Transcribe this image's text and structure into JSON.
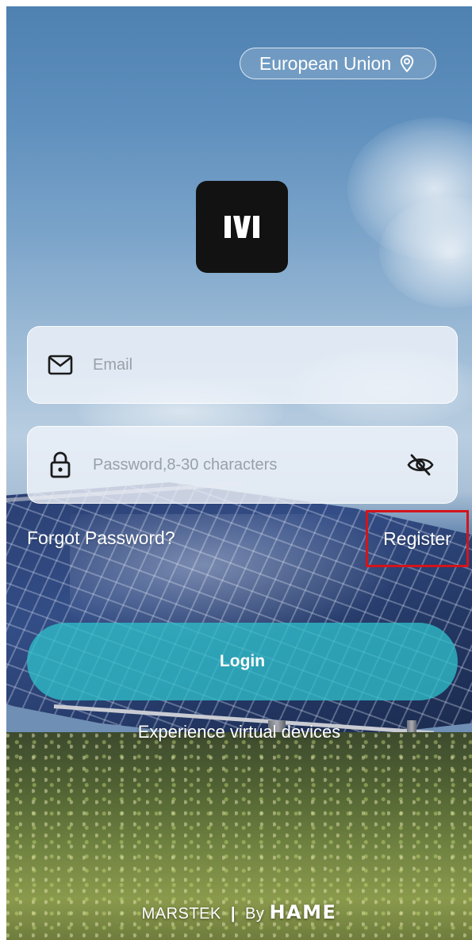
{
  "region": {
    "label": "European Union",
    "icon": "location-pin-icon"
  },
  "logo": {
    "icon": "marstek-logo-icon"
  },
  "email": {
    "placeholder": "Email",
    "value": "",
    "icon": "mail-icon"
  },
  "password": {
    "placeholder": "Password,8-30 characters",
    "value": "",
    "icon": "lock-icon",
    "toggle_icon": "eye-slash-icon"
  },
  "links": {
    "forgot": "Forgot Password?",
    "register": "Register"
  },
  "login": {
    "label": "Login"
  },
  "virtual": {
    "label": "Experience virtual devices"
  },
  "footer": {
    "brand": "MARSTEK",
    "separator": "|",
    "by": "By",
    "company": "HAME"
  },
  "colors": {
    "accent": "#30bec9",
    "highlight_box": "#d4141b",
    "logo_bg": "#121212"
  }
}
